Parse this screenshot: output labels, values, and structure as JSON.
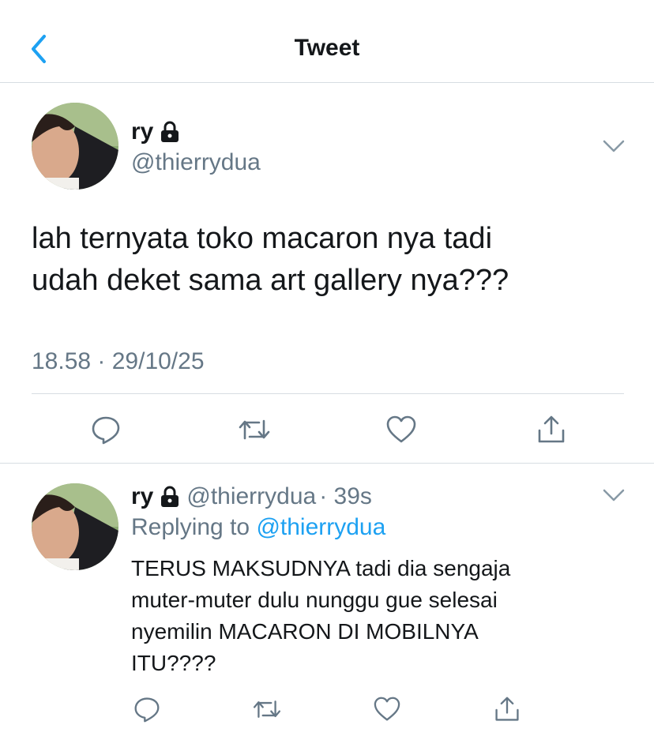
{
  "header": {
    "title": "Tweet"
  },
  "tweet": {
    "name": "ry",
    "handle": "@thierrydua",
    "text_line1": "lah ternyata toko macaron nya tadi",
    "text_line2": "udah deket sama art gallery nya???",
    "timestamp": "18.58 · 29/10/25"
  },
  "reply": {
    "name": "ry",
    "handle": "@thierrydua",
    "time": "· 39s",
    "replying_prefix": "Replying to",
    "replying_handle": "@thierrydua",
    "line1": "TERUS MAKSUDNYA tadi dia sengaja",
    "line2": "muter-muter dulu nunggu gue selesai",
    "line3": "nyemilin MACARON DI MOBILNYA",
    "line4": "ITU????"
  },
  "colors": {
    "accent": "#1da1f2",
    "muted": "#657786",
    "text": "#14171a",
    "icon": "#657786"
  },
  "icons": [
    "chevron-left-icon",
    "lock-icon",
    "chevron-down-icon",
    "reply-icon",
    "retweet-icon",
    "like-icon",
    "share-icon"
  ]
}
